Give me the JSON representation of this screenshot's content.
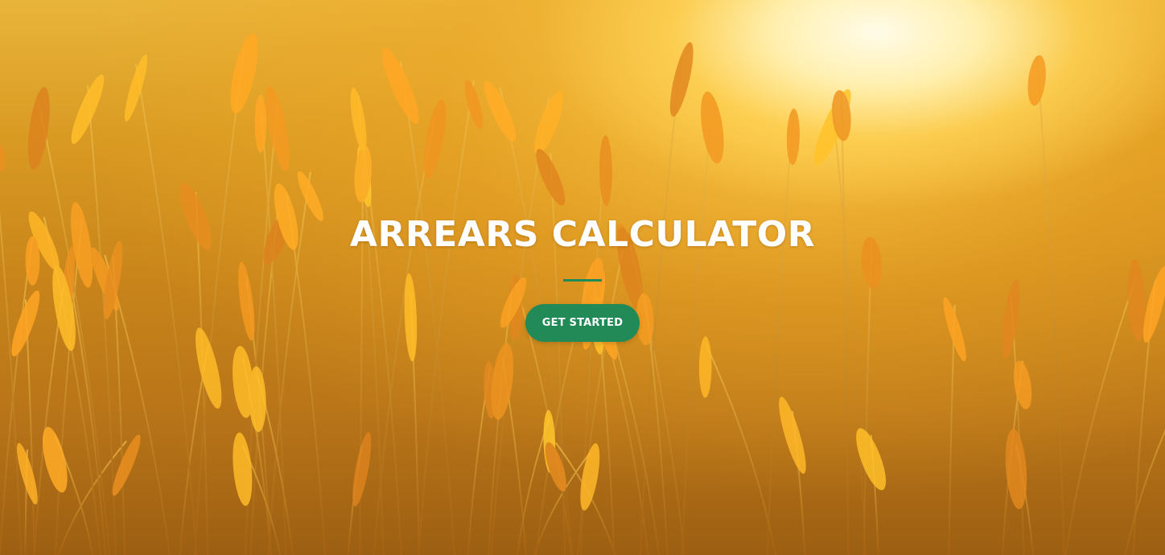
{
  "hero": {
    "title": "ARREARS CALCULATOR",
    "cta_label": "GET STARTED",
    "background": "wheat-field-photo",
    "accent_color": "#228a57"
  }
}
